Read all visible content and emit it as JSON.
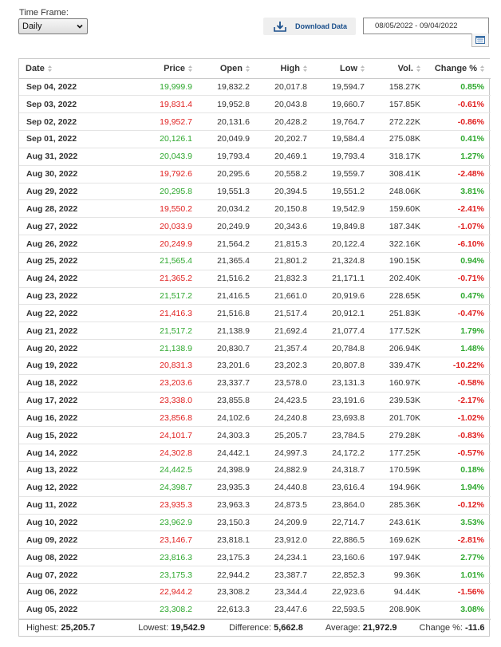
{
  "controls": {
    "time_frame_label": "Time Frame:",
    "time_frame_value": "Daily",
    "download_label": "Download Data",
    "date_range": "08/05/2022 - 09/04/2022"
  },
  "columns": [
    "Date",
    "Price",
    "Open",
    "High",
    "Low",
    "Vol.",
    "Change %"
  ],
  "rows": [
    {
      "date": "Sep 04, 2022",
      "price": "19,999.9",
      "open": "19,832.2",
      "high": "20,017.8",
      "low": "19,594.7",
      "vol": "158.27K",
      "change": "0.85%",
      "dir": "up"
    },
    {
      "date": "Sep 03, 2022",
      "price": "19,831.4",
      "open": "19,952.8",
      "high": "20,043.8",
      "low": "19,660.7",
      "vol": "157.85K",
      "change": "-0.61%",
      "dir": "down"
    },
    {
      "date": "Sep 02, 2022",
      "price": "19,952.7",
      "open": "20,131.6",
      "high": "20,428.2",
      "low": "19,764.7",
      "vol": "272.22K",
      "change": "-0.86%",
      "dir": "down"
    },
    {
      "date": "Sep 01, 2022",
      "price": "20,126.1",
      "open": "20,049.9",
      "high": "20,202.7",
      "low": "19,584.4",
      "vol": "275.08K",
      "change": "0.41%",
      "dir": "up"
    },
    {
      "date": "Aug 31, 2022",
      "price": "20,043.9",
      "open": "19,793.4",
      "high": "20,469.1",
      "low": "19,793.4",
      "vol": "318.17K",
      "change": "1.27%",
      "dir": "up"
    },
    {
      "date": "Aug 30, 2022",
      "price": "19,792.6",
      "open": "20,295.6",
      "high": "20,558.2",
      "low": "19,559.7",
      "vol": "308.41K",
      "change": "-2.48%",
      "dir": "down"
    },
    {
      "date": "Aug 29, 2022",
      "price": "20,295.8",
      "open": "19,551.3",
      "high": "20,394.5",
      "low": "19,551.2",
      "vol": "248.06K",
      "change": "3.81%",
      "dir": "up"
    },
    {
      "date": "Aug 28, 2022",
      "price": "19,550.2",
      "open": "20,034.2",
      "high": "20,150.8",
      "low": "19,542.9",
      "vol": "159.60K",
      "change": "-2.41%",
      "dir": "down"
    },
    {
      "date": "Aug 27, 2022",
      "price": "20,033.9",
      "open": "20,249.9",
      "high": "20,343.6",
      "low": "19,849.8",
      "vol": "187.34K",
      "change": "-1.07%",
      "dir": "down"
    },
    {
      "date": "Aug 26, 2022",
      "price": "20,249.9",
      "open": "21,564.2",
      "high": "21,815.3",
      "low": "20,122.4",
      "vol": "322.16K",
      "change": "-6.10%",
      "dir": "down"
    },
    {
      "date": "Aug 25, 2022",
      "price": "21,565.4",
      "open": "21,365.4",
      "high": "21,801.2",
      "low": "21,324.8",
      "vol": "190.15K",
      "change": "0.94%",
      "dir": "up"
    },
    {
      "date": "Aug 24, 2022",
      "price": "21,365.2",
      "open": "21,516.2",
      "high": "21,832.3",
      "low": "21,171.1",
      "vol": "202.40K",
      "change": "-0.71%",
      "dir": "down"
    },
    {
      "date": "Aug 23, 2022",
      "price": "21,517.2",
      "open": "21,416.5",
      "high": "21,661.0",
      "low": "20,919.6",
      "vol": "228.65K",
      "change": "0.47%",
      "dir": "up"
    },
    {
      "date": "Aug 22, 2022",
      "price": "21,416.3",
      "open": "21,516.8",
      "high": "21,517.4",
      "low": "20,912.1",
      "vol": "251.83K",
      "change": "-0.47%",
      "dir": "down"
    },
    {
      "date": "Aug 21, 2022",
      "price": "21,517.2",
      "open": "21,138.9",
      "high": "21,692.4",
      "low": "21,077.4",
      "vol": "177.52K",
      "change": "1.79%",
      "dir": "up"
    },
    {
      "date": "Aug 20, 2022",
      "price": "21,138.9",
      "open": "20,830.7",
      "high": "21,357.4",
      "low": "20,784.8",
      "vol": "206.94K",
      "change": "1.48%",
      "dir": "up"
    },
    {
      "date": "Aug 19, 2022",
      "price": "20,831.3",
      "open": "23,201.6",
      "high": "23,202.3",
      "low": "20,807.8",
      "vol": "339.47K",
      "change": "-10.22%",
      "dir": "down"
    },
    {
      "date": "Aug 18, 2022",
      "price": "23,203.6",
      "open": "23,337.7",
      "high": "23,578.0",
      "low": "23,131.3",
      "vol": "160.97K",
      "change": "-0.58%",
      "dir": "down"
    },
    {
      "date": "Aug 17, 2022",
      "price": "23,338.0",
      "open": "23,855.8",
      "high": "24,423.5",
      "low": "23,191.6",
      "vol": "239.53K",
      "change": "-2.17%",
      "dir": "down"
    },
    {
      "date": "Aug 16, 2022",
      "price": "23,856.8",
      "open": "24,102.6",
      "high": "24,240.8",
      "low": "23,693.8",
      "vol": "201.70K",
      "change": "-1.02%",
      "dir": "down"
    },
    {
      "date": "Aug 15, 2022",
      "price": "24,101.7",
      "open": "24,303.3",
      "high": "25,205.7",
      "low": "23,784.5",
      "vol": "279.28K",
      "change": "-0.83%",
      "dir": "down"
    },
    {
      "date": "Aug 14, 2022",
      "price": "24,302.8",
      "open": "24,442.1",
      "high": "24,997.3",
      "low": "24,172.2",
      "vol": "177.25K",
      "change": "-0.57%",
      "dir": "down"
    },
    {
      "date": "Aug 13, 2022",
      "price": "24,442.5",
      "open": "24,398.9",
      "high": "24,882.9",
      "low": "24,318.7",
      "vol": "170.59K",
      "change": "0.18%",
      "dir": "up"
    },
    {
      "date": "Aug 12, 2022",
      "price": "24,398.7",
      "open": "23,935.3",
      "high": "24,440.8",
      "low": "23,616.4",
      "vol": "194.96K",
      "change": "1.94%",
      "dir": "up"
    },
    {
      "date": "Aug 11, 2022",
      "price": "23,935.3",
      "open": "23,963.3",
      "high": "24,873.5",
      "low": "23,864.0",
      "vol": "285.36K",
      "change": "-0.12%",
      "dir": "down"
    },
    {
      "date": "Aug 10, 2022",
      "price": "23,962.9",
      "open": "23,150.3",
      "high": "24,209.9",
      "low": "22,714.7",
      "vol": "243.61K",
      "change": "3.53%",
      "dir": "up"
    },
    {
      "date": "Aug 09, 2022",
      "price": "23,146.7",
      "open": "23,818.1",
      "high": "23,912.0",
      "low": "22,886.5",
      "vol": "169.62K",
      "change": "-2.81%",
      "dir": "down"
    },
    {
      "date": "Aug 08, 2022",
      "price": "23,816.3",
      "open": "23,175.3",
      "high": "24,234.1",
      "low": "23,160.6",
      "vol": "197.94K",
      "change": "2.77%",
      "dir": "up"
    },
    {
      "date": "Aug 07, 2022",
      "price": "23,175.3",
      "open": "22,944.2",
      "high": "23,387.7",
      "low": "22,852.3",
      "vol": "99.36K",
      "change": "1.01%",
      "dir": "up"
    },
    {
      "date": "Aug 06, 2022",
      "price": "22,944.2",
      "open": "23,308.2",
      "high": "23,344.4",
      "low": "22,923.6",
      "vol": "94.44K",
      "change": "-1.56%",
      "dir": "down"
    },
    {
      "date": "Aug 05, 2022",
      "price": "23,308.2",
      "open": "22,613.3",
      "high": "23,447.6",
      "low": "22,593.5",
      "vol": "208.90K",
      "change": "3.08%",
      "dir": "up"
    }
  ],
  "summary": {
    "highest_label": "Highest:",
    "highest": "25,205.7",
    "lowest_label": "Lowest:",
    "lowest": "19,542.9",
    "difference_label": "Difference:",
    "difference": "5,662.8",
    "average_label": "Average:",
    "average": "21,972.9",
    "change_label": "Change %:",
    "change": "-11.6"
  },
  "colors": {
    "up": "#2ea82e",
    "down": "#e02020",
    "link": "#1a4f8b"
  }
}
